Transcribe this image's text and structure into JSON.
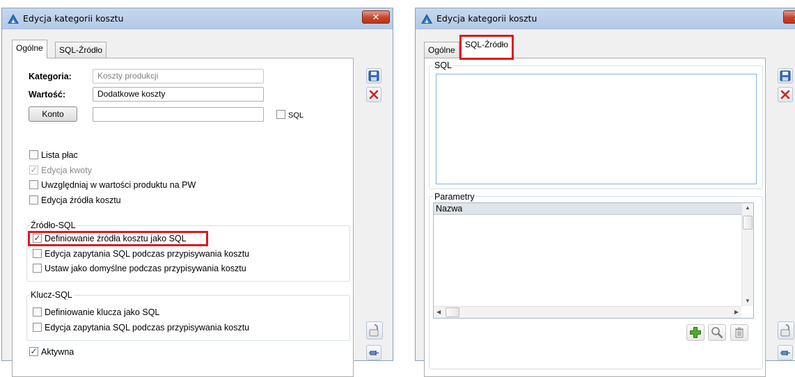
{
  "windows": {
    "left": {
      "title": "Edycja kategorii kosztu",
      "close_glyph": "✕",
      "tabs": [
        "Ogólne",
        "SQL-Źródło"
      ],
      "active_tab": "Ogólne",
      "form": {
        "kategoria_label": "Kategoria:",
        "kategoria_value": "Koszty produkcji",
        "wartosc_label": "Wartość:",
        "wartosc_value": "Dodatkowe koszty",
        "konto_button": "Konto",
        "konto_value": "",
        "sql_checkbox_label": "SQL"
      },
      "checkboxes": [
        {
          "label": "Lista płac",
          "checked": false,
          "enabled": true
        },
        {
          "label": "Edycja kwoty",
          "checked": true,
          "enabled": false
        },
        {
          "label": "Uwzględniaj w wartości produktu na PW",
          "checked": false,
          "enabled": true
        },
        {
          "label": "Edycja źródła kosztu",
          "checked": false,
          "enabled": true
        }
      ],
      "zrodlo_sql": {
        "title": "Źródło-SQL",
        "items": [
          {
            "label": "Definiowanie źródła kosztu jako SQL",
            "checked": true
          },
          {
            "label": "Edycja zapytania SQL podczas przypisywania kosztu",
            "checked": false
          },
          {
            "label": "Ustaw jako domyślne podczas przypisywania kosztu",
            "checked": false
          }
        ]
      },
      "klucz_sql": {
        "title": "Klucz-SQL",
        "items": [
          {
            "label": "Definiowanie klucza jako SQL",
            "checked": false
          },
          {
            "label": "Edycja zapytania SQL podczas przypisywania kosztu",
            "checked": false
          }
        ]
      },
      "aktywna": {
        "label": "Aktywna",
        "checked": true
      }
    },
    "right": {
      "title": "Edycja kategorii kosztu",
      "close_glyph": "✕",
      "tabs": [
        "Ogólne",
        "SQL-Źródło"
      ],
      "active_tab": "SQL-Źródło",
      "sql_group_title": "SQL",
      "sql_text": "",
      "parametry_title": "Parametry",
      "parametry_columns": [
        "Nazwa"
      ],
      "parametry_rows": []
    }
  },
  "icons": {
    "save": "floppy-disk-icon",
    "cancel": "red-x-icon",
    "lock": "padlock-icon",
    "pin": "pin-icon",
    "add": "green-plus-icon",
    "search": "magnifier-icon",
    "delete": "trash-icon",
    "app": "blue-triangle-icon"
  },
  "colors": {
    "highlight": "#e0161d",
    "titlebar": "#c7d8ee",
    "close_button": "#c7432b"
  }
}
